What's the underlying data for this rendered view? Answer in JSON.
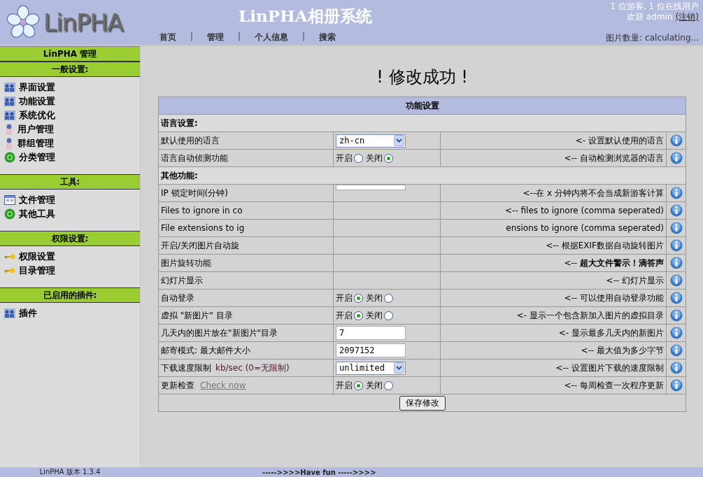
{
  "header": {
    "logo_text": "LinPHA",
    "title": "LinPHA相册系统",
    "nav": [
      "首页",
      "管理",
      "个人信息",
      "搜索"
    ],
    "nav_separator": "|",
    "online": "1 位游客, 1 位在线用户",
    "welcome": "欢迎  admin",
    "logout": "(注销)",
    "image_count": "图片数量: calculating..."
  },
  "sidebar": {
    "title": "LinPHA 管理",
    "sections": [
      {
        "title": "一般设置:",
        "items": [
          {
            "label": "界面设置",
            "kind": "group"
          },
          {
            "label": "功能设置",
            "kind": "group"
          },
          {
            "label": "系统优化",
            "kind": "group"
          },
          {
            "label": "用户管理",
            "kind": "user"
          },
          {
            "label": "群组管理",
            "kind": "user"
          },
          {
            "label": "分类管理",
            "kind": "flower"
          }
        ]
      },
      {
        "title": "工具:",
        "items": [
          {
            "label": "文件管理",
            "kind": "file"
          },
          {
            "label": "其他工具",
            "kind": "flower"
          }
        ]
      },
      {
        "title": "权限设置:",
        "items": [
          {
            "label": "权限设置",
            "kind": "key"
          },
          {
            "label": "目录管理",
            "kind": "key"
          }
        ]
      },
      {
        "title": "已启用的插件:",
        "items": [
          {
            "label": "插件",
            "kind": "group"
          }
        ]
      }
    ]
  },
  "message": "! 修改成功 !",
  "table": {
    "title": "功能设置",
    "rows": [
      {
        "kind": "section",
        "label": "语言设置:"
      },
      {
        "kind": "select",
        "label": "默认使用的语言",
        "value": "zh-cn",
        "note": "<- 设置默认使用的语言"
      },
      {
        "kind": "radio",
        "label": "语言自动侦测功能",
        "options": [
          {
            "label": "开启",
            "selected": false
          },
          {
            "label": "关闭",
            "selected": true
          }
        ],
        "note": "<-- 自动检测浏览器的语言"
      },
      {
        "kind": "section",
        "label": "其他功能:"
      },
      {
        "kind": "text",
        "label": "IP 锁定时间(分钟)",
        "note": "<--在  x 分钟内将不会当成新游客计算"
      },
      {
        "kind": "hidden",
        "label": "Files to ignore in co",
        "note": "<-- files to ignore (comma seperated)"
      },
      {
        "kind": "hidden",
        "label": "File extensions to ig",
        "note": "ensions to ignore (comma seperated)"
      },
      {
        "kind": "hidden",
        "label": "开启/关闭图片自动旋",
        "note": "<-- 根据EXIF数据自动旋转图片"
      },
      {
        "kind": "hidden",
        "label": "图片旋转功能",
        "note": "<-- **超大文件警示！滴答声**"
      },
      {
        "kind": "hidden",
        "label": "幻灯片显示",
        "note": "<-- 幻灯片显示"
      },
      {
        "kind": "radio",
        "label": "自动登录",
        "options": [
          {
            "label": "开启",
            "selected": true
          },
          {
            "label": "关闭",
            "selected": false
          }
        ],
        "note": "<-- 可以使用自动登录功能"
      },
      {
        "kind": "radio",
        "label": "虚拟 \"新图片\" 目录",
        "options": [
          {
            "label": "开启",
            "selected": true
          },
          {
            "label": "关闭",
            "selected": false
          }
        ],
        "note": "<- 显示一个包含新加入图片的虚拟目录"
      },
      {
        "kind": "text",
        "label": "几天内的图片放在\"新图片\"目录",
        "value": "7",
        "note": "<- 显示最多几天内的新图片"
      },
      {
        "kind": "text",
        "label": "邮寄模式: 最大邮件大小",
        "value": "2097152",
        "note": "<-- 最大值为多少字节"
      },
      {
        "kind": "select",
        "label": "下载速度限制",
        "label_extra": "kb/sec (0=无限制)",
        "value": "unlimited",
        "note": "<-- 设置图片下载的速度限制"
      },
      {
        "kind": "radio",
        "label": "更新检查",
        "link": "Check now",
        "options": [
          {
            "label": "开启",
            "selected": true
          },
          {
            "label": "关闭",
            "selected": false
          }
        ],
        "note": "<-- 每周检查一次程序更新"
      }
    ],
    "save_button": "保存修改"
  },
  "footer": {
    "version": "LinPHA 版本 1.3.4",
    "motto": "----->>>>Have fun ----->>>>"
  }
}
